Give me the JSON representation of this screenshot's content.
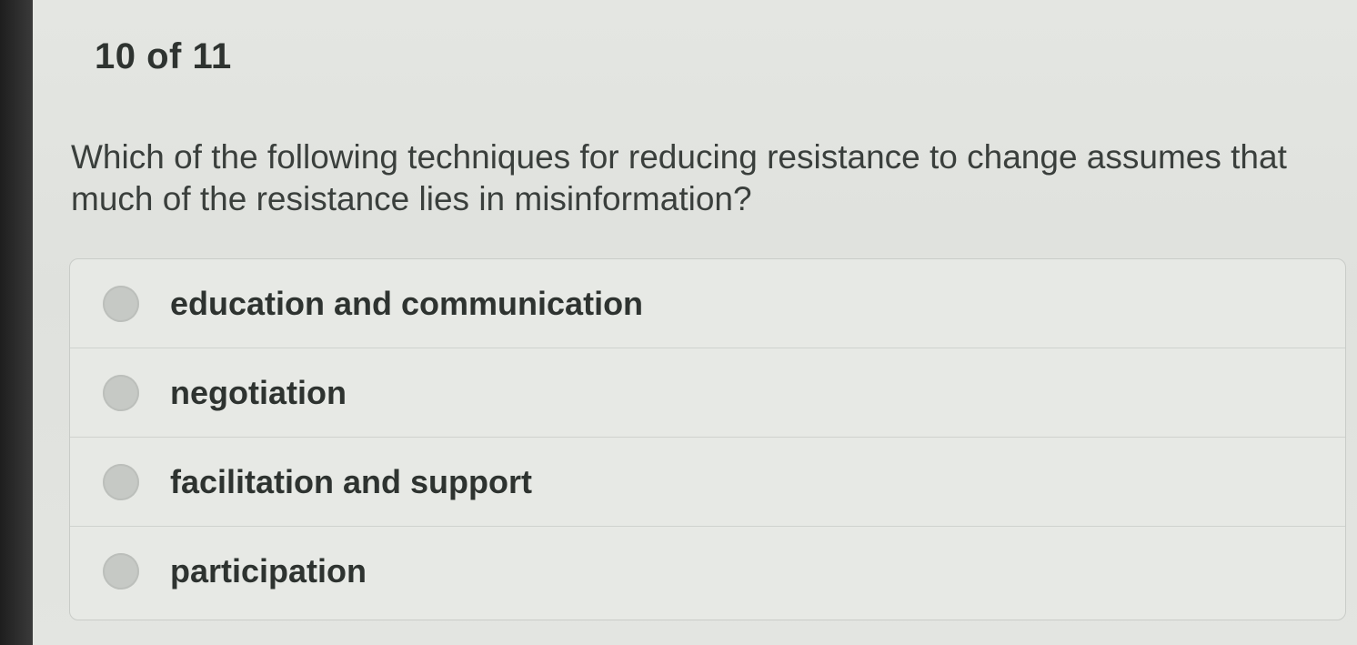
{
  "quiz": {
    "counter": "10 of 11",
    "question": "Which of the following techniques for reducing resistance to change assumes that much of the resistance lies in misinformation?",
    "options": [
      {
        "label": "education and communication"
      },
      {
        "label": "negotiation"
      },
      {
        "label": "facilitation and support"
      },
      {
        "label": "participation"
      }
    ]
  }
}
